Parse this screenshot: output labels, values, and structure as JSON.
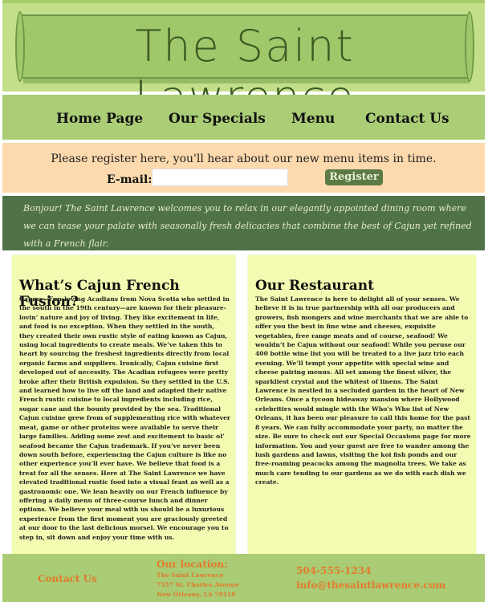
{
  "header": {
    "site_title": "The Saint Lawrence"
  },
  "nav": {
    "items": [
      "Home Page",
      "Our  Specials",
      "Menu",
      "Contact Us"
    ]
  },
  "register": {
    "prompt": "Please register here, you'll  hear about our new menu items in time.",
    "email_label": "E-mail:",
    "email_value": "",
    "email_placeholder": "",
    "button_label": "Register"
  },
  "welcome": {
    "text": "Bonjour! The Saint Lawrence welcomes you to relax in our elegantly appointed dining room where we can tease your palate with seasonally fresh delicacies that combine the best of Cajun yet refined with a French flair."
  },
  "left_column": {
    "heading": "What’s Cajun French Fusion?",
    "body": "Cajuns—Fun-loving Acadians from Nova Scotia who settled in the south in the 19th century—are known for their pleasure-lovin’ nature and joy of living. They like excitement in life, and food is no exception. When they settled in the south, they created their own rustic style of eating known as Cajun, using local ingredients to create meals. We’ve taken this to heart by sourcing the freshest ingredients directly from local organic farms and suppliers. Ironically, Cajun cuisine first developed out of necessity. The Acadian refugees were pretty broke after their British expulsion. So they settled in the U.S. and learned how to live off the land and adapted their native French rustic cuisine to local ingredients including rice, sugar cane and the bounty provided by the sea. Traditional Cajun cuisine grew from of supplementing rice with whatever meat, game or other proteins were available to serve their large families. Adding some zest and excitement to basic ol’ seafood became the Cajun trademark. If you’ve never been down south before, experiencing the Cajun culture is like no other experience you’ll ever have.  We believe that food is a treat for all the senses. Here at The Saint Lawrence we have elevated traditional rustic food into a visual feast as well as a gastronomic one. We lean heavily on our French influence by offering a daily menu of three-course lunch and dinner options.  We believe your meal with us should be a luxurious experience from the first moment you are graciously greeted at our door to the last delicious morsel. We encourage you to step in, sit down   and enjoy your time with us."
  },
  "right_column": {
    "heading": "Our Restaurant",
    "body": "The Saint Lawrence is here to delight all of your senses. We believe it is in true partnership with all our producers and growers, fish mongers and wine merchants that we are able to offer you the best in fine wine and cheeses, exquisite vegetables, free range meats and of course, seafood! We wouldn’t be Cajun without our seafood! While you peruse our 400 bottle wine list you will be treated to a live jazz trio each evening. We’ll   tempt your appetite with special wine and cheese pairing menus. All set among the finest silver, the sparkliest crystal and the whitest of linens. The Saint Lawrence is nestled in a secluded garden in the heart of New Orleans. Once a tycoon hideaway mansion where Hollywood celebrities would mingle with the Who’s Who list of New Orleans, it has been our pleasure to call this home for the past 8 years. We can fully accommodate your party, no matter the size. Be sure to check out our Special Occasions page for more information. You and your guest are free to wander among the lush gardens and lawns, visiting the koi fish ponds and our free-roaming peacocks among the magnolia trees. We take as much care tending to our gardens as we do with each dish we create."
  },
  "footer": {
    "contact_link": "Contact Us",
    "location_title": "Our location:",
    "address_lines": [
      "The Saint Lawrence",
      "7557 St. Charles Avenue",
      "New Orleans, LA 70118"
    ],
    "phone": "504-555-1234",
    "email": "info@thesaintlawrence.com"
  },
  "colors": {
    "banner": "#c3df8a",
    "nav": "#aacd76",
    "register_bg": "#fcdaad",
    "welcome_bg": "#4f7248",
    "column_bg": "#f2fbb1",
    "footer_text": "#e27a2c"
  }
}
